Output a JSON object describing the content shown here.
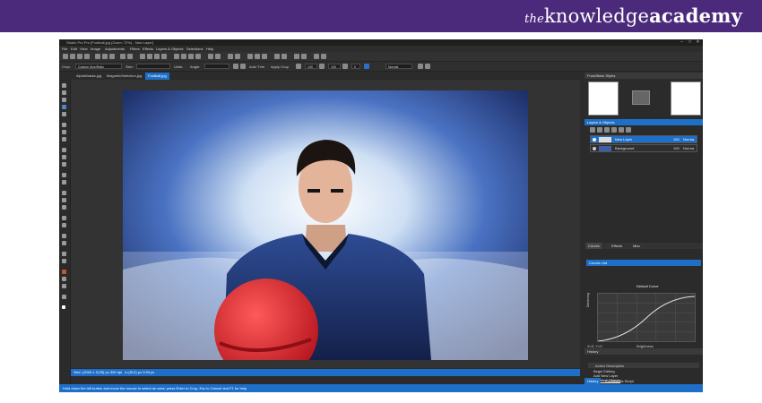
{
  "brand": {
    "prefix": "the",
    "part1": "knowledge",
    "part2": "academy"
  },
  "window": {
    "title": "Studio Pro Pro [Football.jpg (Zoom: 72%) - New Layer]",
    "controls": [
      "–",
      "□",
      "✕"
    ]
  },
  "menu": [
    "File",
    "Edit",
    "View",
    "Image",
    "Adjustments",
    "Filters",
    "Effects",
    "Layers & Objects",
    "Selections",
    "Help"
  ],
  "options_bar": {
    "crop_label": "Crop:",
    "crop_value": "Custom Size/Ratio",
    "size_label": "Size:",
    "units_label": "Units:",
    "angle_label": "Angle:",
    "auto_trim": "Auto Trim",
    "apply_crop": "Apply Crop",
    "value1": "100",
    "value2": "100",
    "value3": "0",
    "blend": "Normal"
  },
  "doc_tabs": [
    "AlphaMasks.jpg",
    "MagneticSelection.jpg",
    "Football.jpg"
  ],
  "status": {
    "size": "Size: (2000 x 1125) px 300 dpi",
    "pos": "x=(Ⅰ0,0) px 9,99 px"
  },
  "hint": "Hold down the left button and move the mouse to select an area; press Enter to Crop, Esc to Cancel and F1 for help",
  "panels": {
    "swatches_title": "Front/Back Styles",
    "layers_title": "Layers & Objects",
    "layers": [
      {
        "name": "New Layer",
        "opacity": "100",
        "mode": "Norma"
      },
      {
        "name": "Background",
        "opacity": "100",
        "mode": "Norma"
      }
    ],
    "adjust_tabs": [
      "Curves",
      "Effects",
      "Misc"
    ],
    "curve_channel": "Curves List",
    "curve_title": "Default Curve",
    "curve_ylabel": "Darkening",
    "curve_xlabel": "Brightness",
    "curve_readout": "X=0, Y=0",
    "curve_ticks_x": [
      "0",
      "20",
      "40",
      "60",
      "80",
      "100"
    ],
    "curve_ticks_y": [
      "100",
      "80",
      "60",
      "40",
      "20",
      "0"
    ],
    "history_title": "History",
    "history_header": "Action Description",
    "history": [
      "Begin Editing",
      "Add New Layer",
      "Deselect Objects"
    ],
    "bottom_tabs": [
      "History",
      "Commands Script"
    ]
  },
  "colors": {
    "accent": "#1e6fc8",
    "banner": "#4b2a7b",
    "jersey": "#1d2f66",
    "helmet": "#d61f26"
  }
}
